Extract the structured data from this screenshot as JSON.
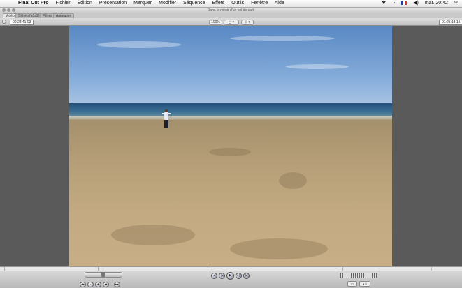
{
  "menubar": {
    "apple_glyph": "",
    "items": [
      "Final Cut Pro",
      "Fichier",
      "Édition",
      "Présentation",
      "Marquer",
      "Modifier",
      "Séquence",
      "Effets",
      "Outils",
      "Fenêtre",
      "Aide"
    ],
    "clock": "mar. 20:42",
    "bluetooth_glyph": "✱",
    "wifi_glyph": "◔",
    "volume_glyph": "◀)",
    "spotlight_glyph": "⚲"
  },
  "window": {
    "title": "Dans le miroir d'un bol de café"
  },
  "tabs": [
    "Vidéo",
    "Stéréo (a1a2)",
    "Filtres",
    "Animation"
  ],
  "controls": {
    "duration_tc": "00:28:41:03",
    "zoom_label": "100%",
    "view_label": "◻︎ ▾",
    "overlay_label": "⊡ ▾",
    "current_tc": "01:25:18:15"
  },
  "transport": {
    "mark_in": "◂|",
    "prev": "|◂",
    "play": "▶",
    "next": "▸|",
    "mark_out": "|▸",
    "left_buttons": [
      "◂▸",
      "◦",
      "◈",
      "◆",
      "▸▸"
    ],
    "right_buttons": [
      "▭",
      "◐▾"
    ]
  },
  "colors": {
    "viewer_bg": "#5a5a5a",
    "chrome": "#c9c9c9"
  }
}
